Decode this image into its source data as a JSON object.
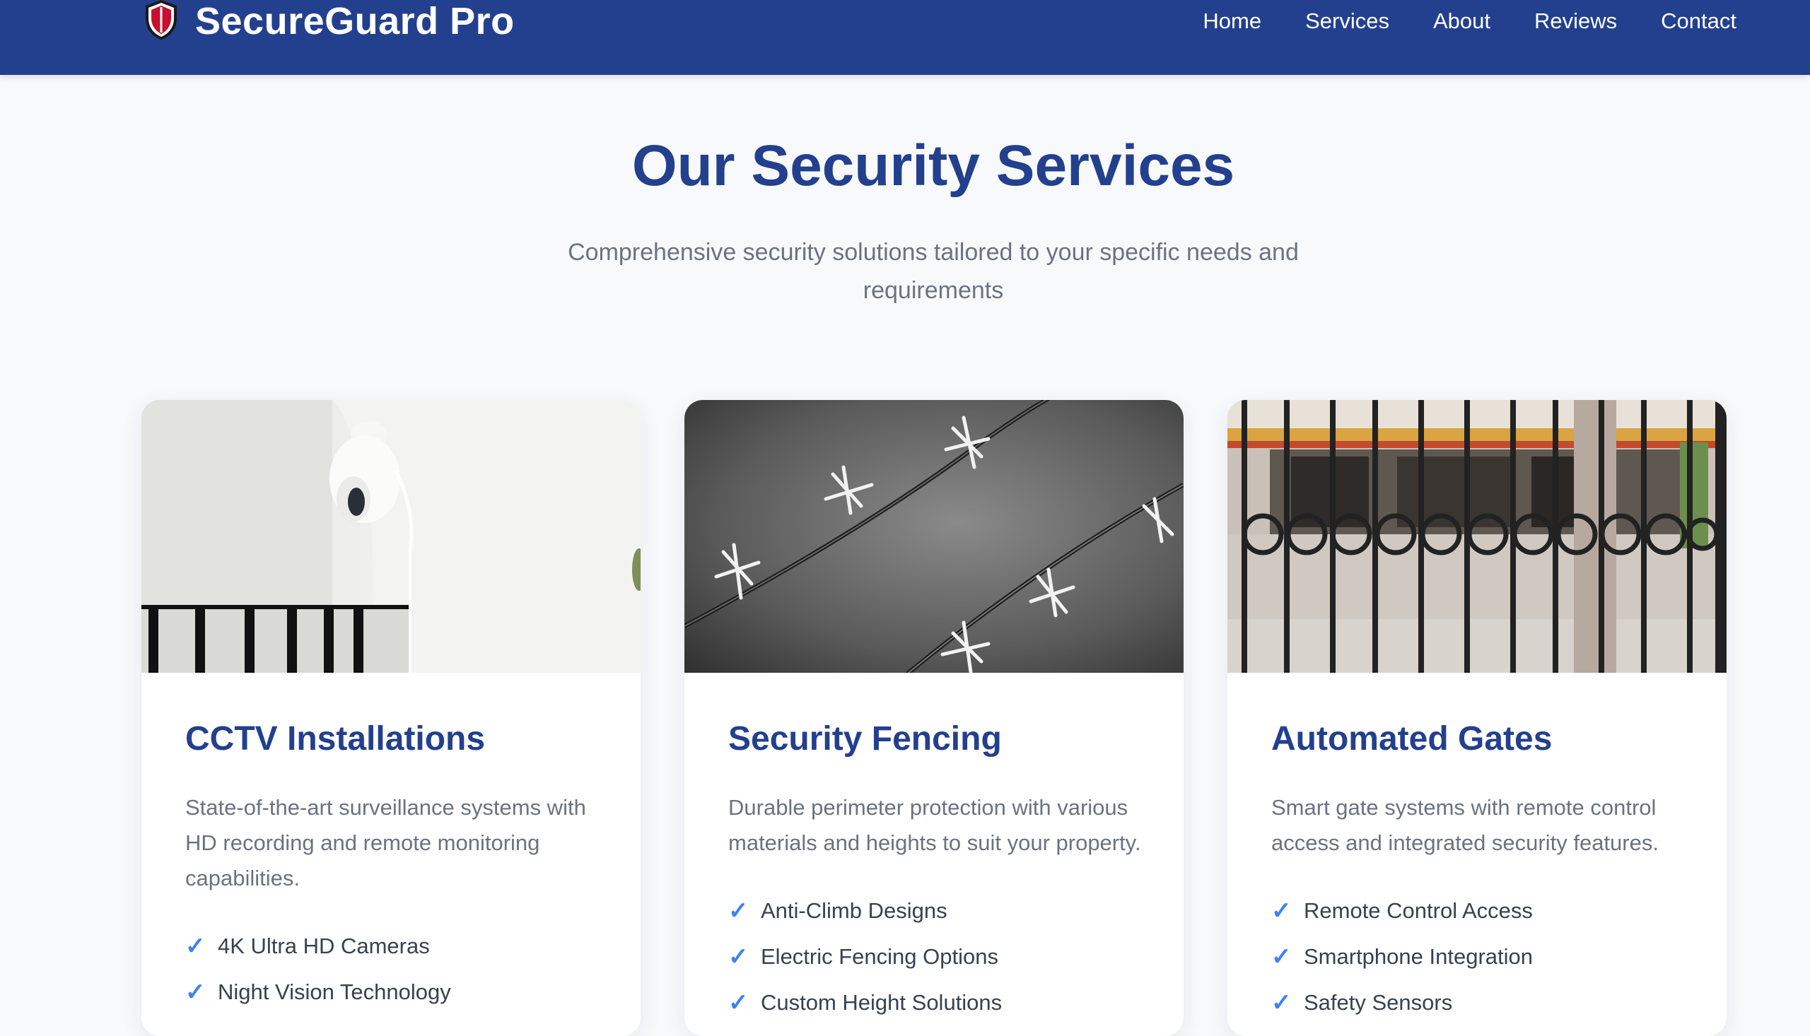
{
  "header": {
    "brand": "SecureGuard Pro",
    "nav": [
      "Home",
      "Services",
      "About",
      "Reviews",
      "Contact"
    ]
  },
  "section": {
    "title": "Our Security Services",
    "subtitle": "Comprehensive security solutions tailored to your specific needs and requirements"
  },
  "cards": [
    {
      "title": "CCTV Installations",
      "description": "State-of-the-art surveillance systems with HD recording and remote monitoring capabilities.",
      "features": [
        "4K Ultra HD Cameras",
        "Night Vision Technology"
      ]
    },
    {
      "title": "Security Fencing",
      "description": "Durable perimeter protection with various materials and heights to suit your property.",
      "features": [
        "Anti-Climb Designs",
        "Electric Fencing Options",
        "Custom Height Solutions"
      ]
    },
    {
      "title": "Automated Gates",
      "description": "Smart gate systems with remote control access and integrated security features.",
      "features": [
        "Remote Control Access",
        "Smartphone Integration",
        "Safety Sensors"
      ]
    }
  ],
  "colors": {
    "primary": "#23408e",
    "accent": "#3b82f6",
    "text_muted": "#6b7280",
    "background": "#f8f9fb",
    "shield_red": "#c8102e"
  },
  "icons": {
    "logo": "shield-icon",
    "feature_bullet": "check-icon"
  }
}
